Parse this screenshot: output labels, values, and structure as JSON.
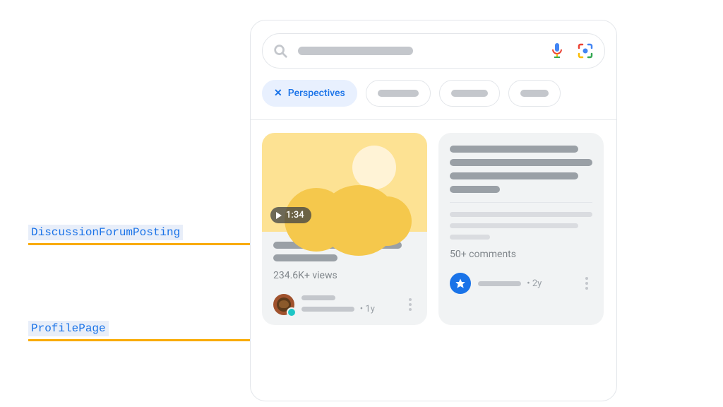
{
  "annotations": {
    "discussion": "DiscussionForumPosting",
    "profile": "ProfilePage"
  },
  "filter_chip": {
    "active_label": "Perspectives"
  },
  "video_card": {
    "duration": "1:34",
    "views": "234.6K+ views",
    "age": "1y"
  },
  "forum_card": {
    "comments": "50+ comments",
    "age": "2y"
  }
}
